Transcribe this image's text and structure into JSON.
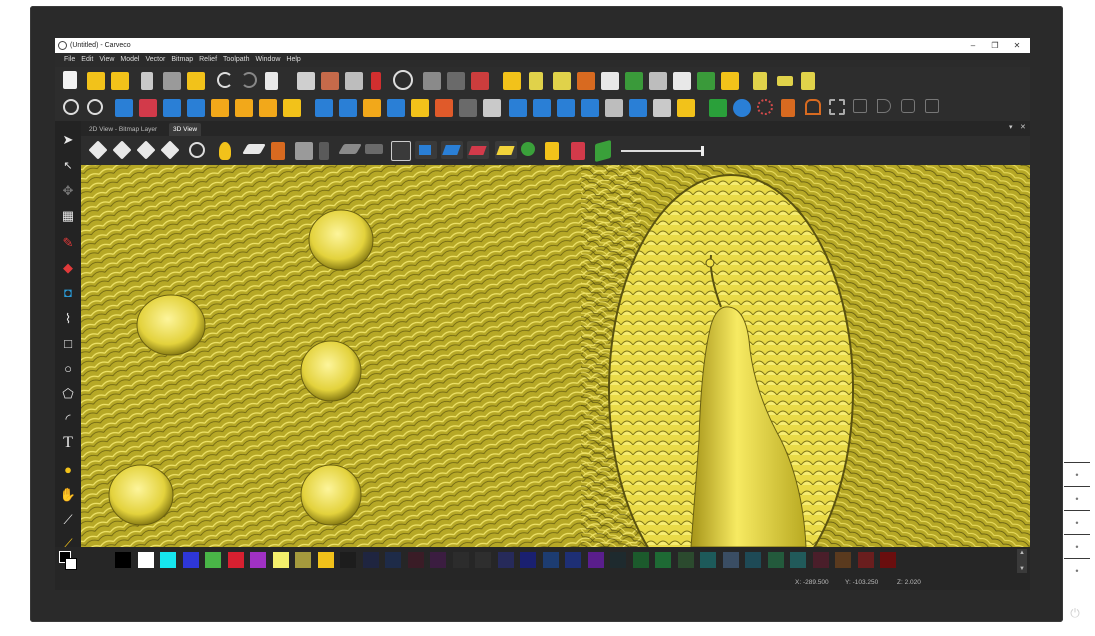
{
  "window": {
    "title": "(Untitled) - Carveco",
    "minimize": "–",
    "maximize": "❐",
    "close": "✕"
  },
  "menu": [
    "File",
    "Edit",
    "View",
    "Model",
    "Vector",
    "Bitmap",
    "Relief",
    "Toolpath",
    "Window",
    "Help"
  ],
  "tabs": [
    {
      "label": "2D View - Bitmap Layer",
      "active": false
    },
    {
      "label": "3D View",
      "active": true
    }
  ],
  "panel_controls": {
    "pin": "▾",
    "close": "✕"
  },
  "status": {
    "x": "X: -289.500",
    "y": "Y: -103.250",
    "z": "Z: 2.020"
  },
  "palette_colors": [
    "#000000",
    "#ffffff",
    "#16e6ee",
    "#2e37d8",
    "#49b547",
    "#d72030",
    "#a031c4",
    "#f4ef6c",
    "#a59a3d",
    "#f2c21a",
    "#1d1d1d",
    "#1f2540",
    "#1e2b48",
    "#3a1c26",
    "#3b1d40",
    "#2c2c2c",
    "#2e2e2e",
    "#262a5a",
    "#1a2070",
    "#1d3c70",
    "#1e2f75",
    "#5a1e8c",
    "#1e2a2e",
    "#1c5a2c",
    "#1e6a34",
    "#2b4a2e",
    "#1d5a5a",
    "#3a4d63",
    "#1e4a56",
    "#235a3c",
    "#215a5a",
    "#4a1e2a",
    "#5a3a1e",
    "#6a1e1e",
    "#6a0e0e"
  ],
  "icons": {
    "left_tools": [
      "select-arrow-icon",
      "node-edit-icon",
      "move-icon",
      "grid-icon",
      "pen-icon",
      "eraser-icon",
      "paint-bucket-icon",
      "polyline-icon",
      "rectangle-icon",
      "circle-icon",
      "polygon-icon",
      "arc-icon",
      "text-icon",
      "drop-icon",
      "brush-icon",
      "knife-icon",
      "pipette-icon"
    ],
    "text_tool_glyph": "T"
  },
  "accent": "#f2d33a"
}
